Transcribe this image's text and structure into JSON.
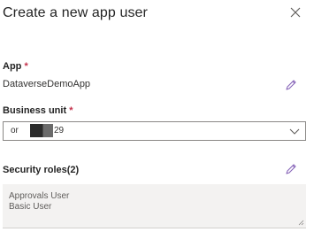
{
  "panel": {
    "title": "Create a new app user"
  },
  "app": {
    "label": "App",
    "required_marker": "*",
    "value": "DataverseDemoApp"
  },
  "business_unit": {
    "label": "Business unit",
    "required_marker": "*",
    "value_prefix": "or",
    "value_suffix": "29"
  },
  "security_roles": {
    "label": "Security roles(2)",
    "roles": [
      "Approvals User",
      "Basic User"
    ]
  },
  "icons": {
    "close": "close-icon",
    "edit": "edit-pencil-icon",
    "chevron": "chevron-down-icon"
  },
  "colors": {
    "accent": "#8764b8",
    "required": "#c4314b"
  }
}
